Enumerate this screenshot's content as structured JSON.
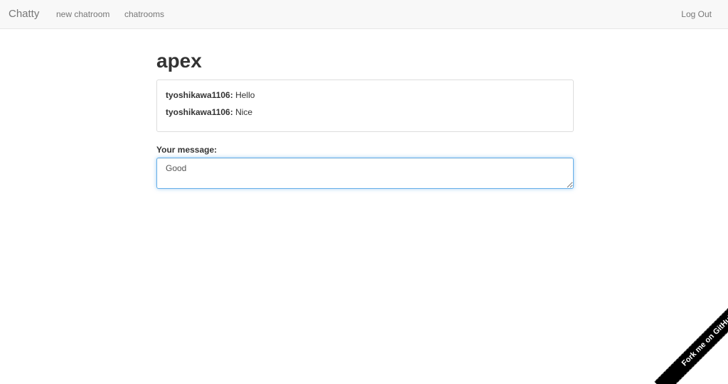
{
  "navbar": {
    "brand": "Chatty",
    "links": [
      "new chatroom",
      "chatrooms"
    ],
    "logout": "Log Out"
  },
  "room": {
    "title": "apex",
    "messages": [
      {
        "user": "tyoshikawa1106:",
        "text": "Hello"
      },
      {
        "user": "tyoshikawa1106:",
        "text": "Nice"
      }
    ]
  },
  "composer": {
    "label": "Your message:",
    "value": "Good"
  },
  "ribbon": {
    "label": "Fork me on GitHub",
    "color": "#000000"
  },
  "colors": {
    "navbar_bg": "#f8f8f8",
    "focus_border": "#66afe9",
    "text": "#333333",
    "muted": "#777777"
  }
}
